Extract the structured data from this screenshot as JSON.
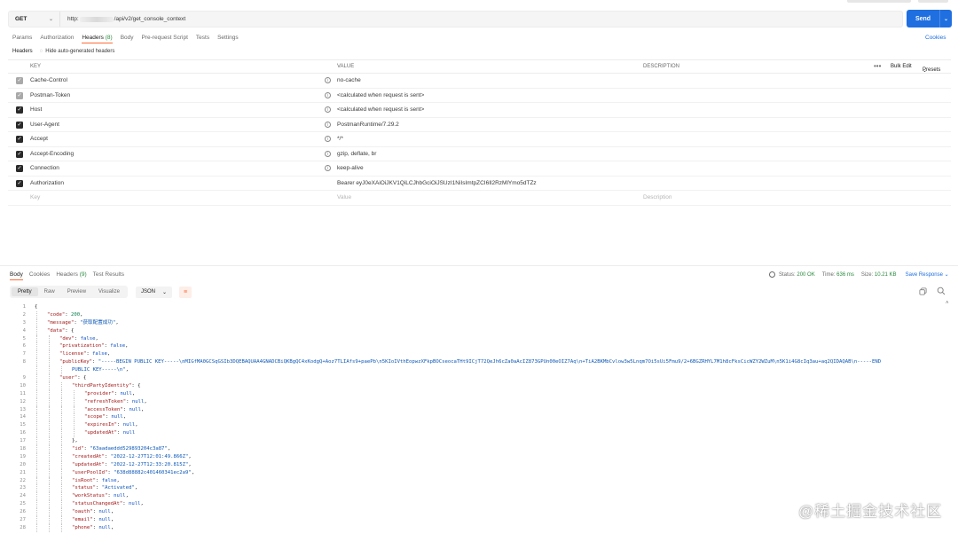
{
  "request": {
    "method": "GET",
    "url_prefix": "http:",
    "url_suffix": "/api/v2/get_console_context",
    "send_label": "Send"
  },
  "request_tabs": [
    {
      "label": "Params"
    },
    {
      "label": "Authorization"
    },
    {
      "label": "Headers",
      "count": "(8)"
    },
    {
      "label": "Body"
    },
    {
      "label": "Pre-request Script"
    },
    {
      "label": "Tests"
    },
    {
      "label": "Settings"
    }
  ],
  "cookies_label": "Cookies",
  "headers_section": {
    "title": "Headers",
    "hide_label": "Hide auto-generated headers"
  },
  "headers_table": {
    "col_key": "KEY",
    "col_value": "VALUE",
    "col_description": "DESCRIPTION",
    "more": "•••",
    "bulk_edit": "Bulk Edit",
    "presets": "Presets",
    "rows": [
      {
        "key": "Cache-Control",
        "value": "no-cache"
      },
      {
        "key": "Postman-Token",
        "value": "<calculated when request is sent>"
      },
      {
        "key": "Host",
        "value": "<calculated when request is sent>"
      },
      {
        "key": "User-Agent",
        "value": "PostmanRuntime/7.29.2"
      },
      {
        "key": "Accept",
        "value": "*/*"
      },
      {
        "key": "Accept-Encoding",
        "value": "gzip, deflate, br"
      },
      {
        "key": "Connection",
        "value": "keep-alive"
      },
      {
        "key": "Authorization",
        "value": "Bearer eyJ0eXAiOiJKV1QiLCJhbGciOiJSUzI1NiIsImtpZCI6Il2RzMlYmo5dTZz"
      }
    ],
    "placeholder": {
      "key": "Key",
      "value": "Value",
      "description": "Description"
    }
  },
  "response_tabs": [
    {
      "label": "Body"
    },
    {
      "label": "Cookies"
    },
    {
      "label": "Headers",
      "count": "(9)"
    },
    {
      "label": "Test Results"
    }
  ],
  "response_status": {
    "status_label": "Status:",
    "status_value": "200 OK",
    "time_label": "Time:",
    "time_value": "636 ms",
    "size_label": "Size:",
    "size_value": "10.21 KB",
    "save_label": "Save Response"
  },
  "view_modes": [
    "Pretty",
    "Raw",
    "Preview",
    "Visualize"
  ],
  "format": "JSON",
  "code_lines": [
    {
      "n": "1",
      "indent": 0,
      "parts": [
        {
          "t": "p",
          "v": "{"
        }
      ]
    },
    {
      "n": "2",
      "indent": 1,
      "parts": [
        {
          "t": "k",
          "v": "\"code\""
        },
        {
          "t": "p",
          "v": ": "
        },
        {
          "t": "n",
          "v": "200"
        },
        {
          "t": "p",
          "v": ","
        }
      ]
    },
    {
      "n": "3",
      "indent": 1,
      "parts": [
        {
          "t": "k",
          "v": "\"message\""
        },
        {
          "t": "p",
          "v": ": "
        },
        {
          "t": "s",
          "v": "\"获取配置成功\""
        },
        {
          "t": "p",
          "v": ","
        }
      ]
    },
    {
      "n": "4",
      "indent": 1,
      "parts": [
        {
          "t": "k",
          "v": "\"data\""
        },
        {
          "t": "p",
          "v": ": {"
        }
      ]
    },
    {
      "n": "5",
      "indent": 2,
      "parts": [
        {
          "t": "k",
          "v": "\"dev\""
        },
        {
          "t": "p",
          "v": ": "
        },
        {
          "t": "b",
          "v": "false"
        },
        {
          "t": "p",
          "v": ","
        }
      ]
    },
    {
      "n": "6",
      "indent": 2,
      "parts": [
        {
          "t": "k",
          "v": "\"privatization\""
        },
        {
          "t": "p",
          "v": ": "
        },
        {
          "t": "b",
          "v": "false"
        },
        {
          "t": "p",
          "v": ","
        }
      ]
    },
    {
      "n": "7",
      "indent": 2,
      "parts": [
        {
          "t": "k",
          "v": "\"license\""
        },
        {
          "t": "p",
          "v": ": "
        },
        {
          "t": "b",
          "v": "false"
        },
        {
          "t": "p",
          "v": ","
        }
      ]
    },
    {
      "n": "8",
      "indent": 2,
      "parts": [
        {
          "t": "k",
          "v": "\"publicKey\""
        },
        {
          "t": "p",
          "v": ": "
        },
        {
          "t": "s",
          "v": "\"-----BEGIN PUBLIC KEY-----\\nMIGfMA0GCSqGSIb3DQEBAQUAA4GNADCBiQKBgQC4xKodgQ+Aoz7TLIAfs9+paePb\\n5KIoIVthEopwzXFkpBOCseocaTHt9ICjT72QeJh6cZa0aAcIZ873GPUn00eOIZ7Aq\\n+TiA2BKMbCvlow3w5Lnqm7Oi5sUi5Fmu9/2+6BGZRHYL7M1h8cFksCicWZY2WZuM\\n5K1i4G8cIq3au+aq2QIDAQAB\\n-----END"
        }
      ]
    },
    {
      "n": "",
      "indent": 3,
      "parts": [
        {
          "t": "s",
          "v": "PUBLIC KEY-----\\n\""
        },
        {
          "t": "p",
          "v": ","
        }
      ]
    },
    {
      "n": "9",
      "indent": 2,
      "parts": [
        {
          "t": "k",
          "v": "\"user\""
        },
        {
          "t": "p",
          "v": ": {"
        }
      ]
    },
    {
      "n": "10",
      "indent": 3,
      "parts": [
        {
          "t": "k",
          "v": "\"thirdPartyIdentity\""
        },
        {
          "t": "p",
          "v": ": {"
        }
      ]
    },
    {
      "n": "11",
      "indent": 4,
      "parts": [
        {
          "t": "k",
          "v": "\"provider\""
        },
        {
          "t": "p",
          "v": ": "
        },
        {
          "t": "nl",
          "v": "null"
        },
        {
          "t": "p",
          "v": ","
        }
      ]
    },
    {
      "n": "12",
      "indent": 4,
      "parts": [
        {
          "t": "k",
          "v": "\"refreshToken\""
        },
        {
          "t": "p",
          "v": ": "
        },
        {
          "t": "nl",
          "v": "null"
        },
        {
          "t": "p",
          "v": ","
        }
      ]
    },
    {
      "n": "13",
      "indent": 4,
      "parts": [
        {
          "t": "k",
          "v": "\"accessToken\""
        },
        {
          "t": "p",
          "v": ": "
        },
        {
          "t": "nl",
          "v": "null"
        },
        {
          "t": "p",
          "v": ","
        }
      ]
    },
    {
      "n": "14",
      "indent": 4,
      "parts": [
        {
          "t": "k",
          "v": "\"scope\""
        },
        {
          "t": "p",
          "v": ": "
        },
        {
          "t": "nl",
          "v": "null"
        },
        {
          "t": "p",
          "v": ","
        }
      ]
    },
    {
      "n": "15",
      "indent": 4,
      "parts": [
        {
          "t": "k",
          "v": "\"expiresIn\""
        },
        {
          "t": "p",
          "v": ": "
        },
        {
          "t": "nl",
          "v": "null"
        },
        {
          "t": "p",
          "v": ","
        }
      ]
    },
    {
      "n": "16",
      "indent": 4,
      "parts": [
        {
          "t": "k",
          "v": "\"updatedAt\""
        },
        {
          "t": "p",
          "v": ": "
        },
        {
          "t": "nl",
          "v": "null"
        }
      ]
    },
    {
      "n": "17",
      "indent": 3,
      "parts": [
        {
          "t": "p",
          "v": "},"
        }
      ]
    },
    {
      "n": "18",
      "indent": 3,
      "parts": [
        {
          "t": "k",
          "v": "\"id\""
        },
        {
          "t": "p",
          "v": ": "
        },
        {
          "t": "s",
          "v": "\"63aadaeddd529893204c3a87\""
        },
        {
          "t": "p",
          "v": ","
        }
      ]
    },
    {
      "n": "19",
      "indent": 3,
      "parts": [
        {
          "t": "k",
          "v": "\"createdAt\""
        },
        {
          "t": "p",
          "v": ": "
        },
        {
          "t": "s",
          "v": "\"2022-12-27T12:01:49.866Z\""
        },
        {
          "t": "p",
          "v": ","
        }
      ]
    },
    {
      "n": "20",
      "indent": 3,
      "parts": [
        {
          "t": "k",
          "v": "\"updatedAt\""
        },
        {
          "t": "p",
          "v": ": "
        },
        {
          "t": "s",
          "v": "\"2022-12-27T12:33:20.815Z\""
        },
        {
          "t": "p",
          "v": ","
        }
      ]
    },
    {
      "n": "21",
      "indent": 3,
      "parts": [
        {
          "t": "k",
          "v": "\"userPoolId\""
        },
        {
          "t": "p",
          "v": ": "
        },
        {
          "t": "s",
          "v": "\"638d88882c401460341ec2a9\""
        },
        {
          "t": "p",
          "v": ","
        }
      ]
    },
    {
      "n": "22",
      "indent": 3,
      "parts": [
        {
          "t": "k",
          "v": "\"isRoot\""
        },
        {
          "t": "p",
          "v": ": "
        },
        {
          "t": "b",
          "v": "false"
        },
        {
          "t": "p",
          "v": ","
        }
      ]
    },
    {
      "n": "23",
      "indent": 3,
      "parts": [
        {
          "t": "k",
          "v": "\"status\""
        },
        {
          "t": "p",
          "v": ": "
        },
        {
          "t": "s",
          "v": "\"Activated\""
        },
        {
          "t": "p",
          "v": ","
        }
      ]
    },
    {
      "n": "24",
      "indent": 3,
      "parts": [
        {
          "t": "k",
          "v": "\"workStatus\""
        },
        {
          "t": "p",
          "v": ": "
        },
        {
          "t": "nl",
          "v": "null"
        },
        {
          "t": "p",
          "v": ","
        }
      ]
    },
    {
      "n": "25",
      "indent": 3,
      "parts": [
        {
          "t": "k",
          "v": "\"statusChangedAt\""
        },
        {
          "t": "p",
          "v": ": "
        },
        {
          "t": "nl",
          "v": "null"
        },
        {
          "t": "p",
          "v": ","
        }
      ]
    },
    {
      "n": "26",
      "indent": 3,
      "parts": [
        {
          "t": "k",
          "v": "\"oauth\""
        },
        {
          "t": "p",
          "v": ": "
        },
        {
          "t": "nl",
          "v": "null"
        },
        {
          "t": "p",
          "v": ","
        }
      ]
    },
    {
      "n": "27",
      "indent": 3,
      "parts": [
        {
          "t": "k",
          "v": "\"email\""
        },
        {
          "t": "p",
          "v": ": "
        },
        {
          "t": "nl",
          "v": "null"
        },
        {
          "t": "p",
          "v": ","
        }
      ]
    },
    {
      "n": "28",
      "indent": 3,
      "parts": [
        {
          "t": "k",
          "v": "\"phone\""
        },
        {
          "t": "p",
          "v": ": "
        },
        {
          "t": "nl",
          "v": "null"
        },
        {
          "t": "p",
          "v": ","
        }
      ]
    }
  ],
  "watermark": "@稀土掘金技术社区",
  "colors": {
    "accent": "#ff6c37",
    "primary": "#1f6fe0",
    "success": "#2b8a3e"
  }
}
